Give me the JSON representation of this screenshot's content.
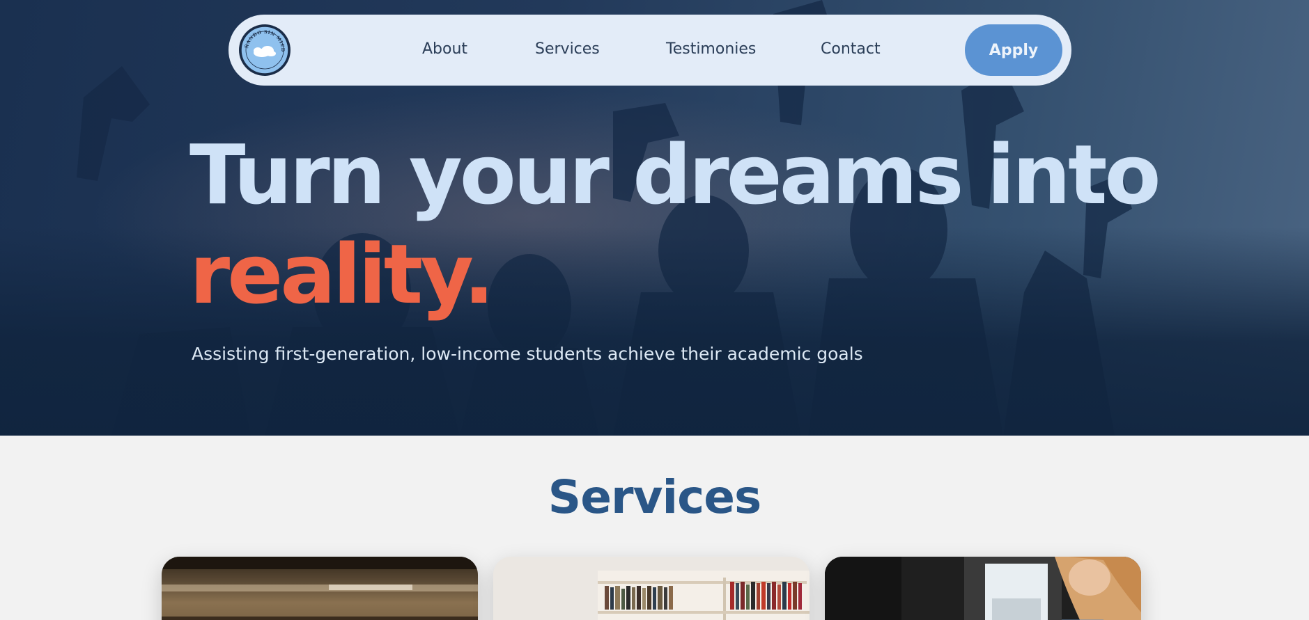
{
  "nav": {
    "logo_text": "SOÑANDO SIN MIEDO",
    "links": [
      {
        "label": "About"
      },
      {
        "label": "Services"
      },
      {
        "label": "Testimonies"
      },
      {
        "label": "Contact"
      }
    ],
    "apply_label": "Apply"
  },
  "hero": {
    "headline_line1": "Turn your dreams into",
    "headline_line2": "reality.",
    "tagline": "Assisting first-generation, low-income students achieve their academic goals"
  },
  "services": {
    "title": "Services",
    "cards": [
      {
        "image": "library-shelves-photo"
      },
      {
        "image": "bookshelf-room-photo"
      },
      {
        "image": "student-studying-photo"
      }
    ]
  },
  "colors": {
    "nav_bg": "#e3ecf8",
    "accent_blue": "#5b93d3",
    "headline_light": "#cfe2f7",
    "headline_accent": "#ef6547",
    "section_title": "#2a5687",
    "page_bg": "#f2f2f2"
  }
}
